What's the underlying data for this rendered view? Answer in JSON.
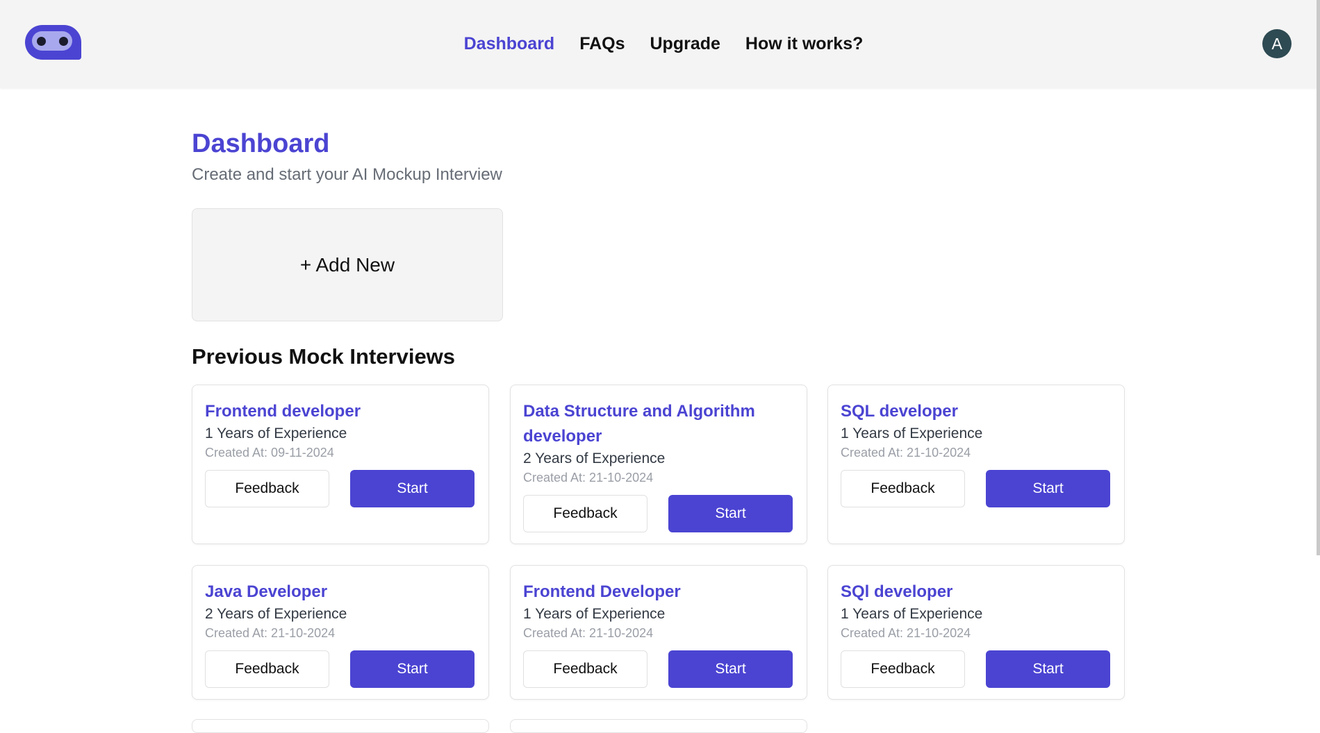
{
  "header": {
    "nav": [
      {
        "label": "Dashboard",
        "active": true
      },
      {
        "label": "FAQs"
      },
      {
        "label": "Upgrade"
      },
      {
        "label": "How it works?"
      }
    ],
    "avatar_initial": "A"
  },
  "main": {
    "title": "Dashboard",
    "subtitle": "Create and start your AI Mockup Interview",
    "add_new_label": "+ Add New",
    "section_title": "Previous Mock Interviews",
    "interviews": [
      {
        "title": "Frontend developer",
        "experience": "1 Years of Experience",
        "created": "Created At: 09-11-2024"
      },
      {
        "title": "Data Structure and Algorithm developer",
        "experience": "2 Years of Experience",
        "created": "Created At: 21-10-2024"
      },
      {
        "title": "SQL developer",
        "experience": "1 Years of Experience",
        "created": "Created At: 21-10-2024"
      },
      {
        "title": "Java Developer",
        "experience": "2 Years of Experience",
        "created": "Created At: 21-10-2024"
      },
      {
        "title": "Frontend Developer",
        "experience": "1 Years of Experience",
        "created": "Created At: 21-10-2024"
      },
      {
        "title": "SQl developer",
        "experience": "1 Years of Experience",
        "created": "Created At: 21-10-2024"
      }
    ],
    "feedback_label": "Feedback",
    "start_label": "Start"
  },
  "colors": {
    "accent": "#4b44d2",
    "header_bg": "#f4f4f4",
    "avatar_bg": "#2e4a52"
  }
}
